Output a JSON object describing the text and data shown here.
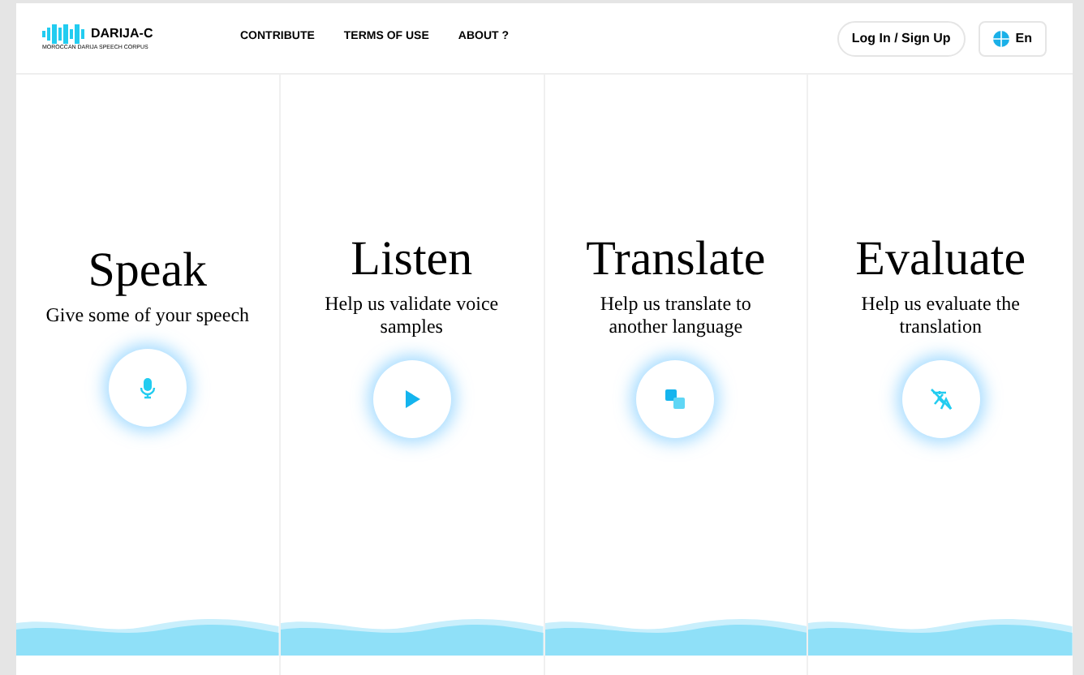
{
  "logo": {
    "name": "DARIJA-C",
    "tagline": "MOROCCAN DARIJA SPEECH CORPUS"
  },
  "nav": [
    "CONTRIBUTE",
    "TERMS OF USE",
    "ABOUT ?"
  ],
  "login_button": "Log In / Sign Up",
  "language_button": "En",
  "cards": [
    {
      "title": "Speak",
      "description": "Give some of your speech",
      "kind": "mic"
    },
    {
      "title": "Listen",
      "description": "Help us validate voice samples",
      "kind": "play"
    },
    {
      "title": "Translate",
      "description": "Help us translate to another language",
      "kind": "translate"
    },
    {
      "title": "Evaluate",
      "description": "Help us evaluate the translation",
      "kind": "evaluate"
    }
  ]
}
